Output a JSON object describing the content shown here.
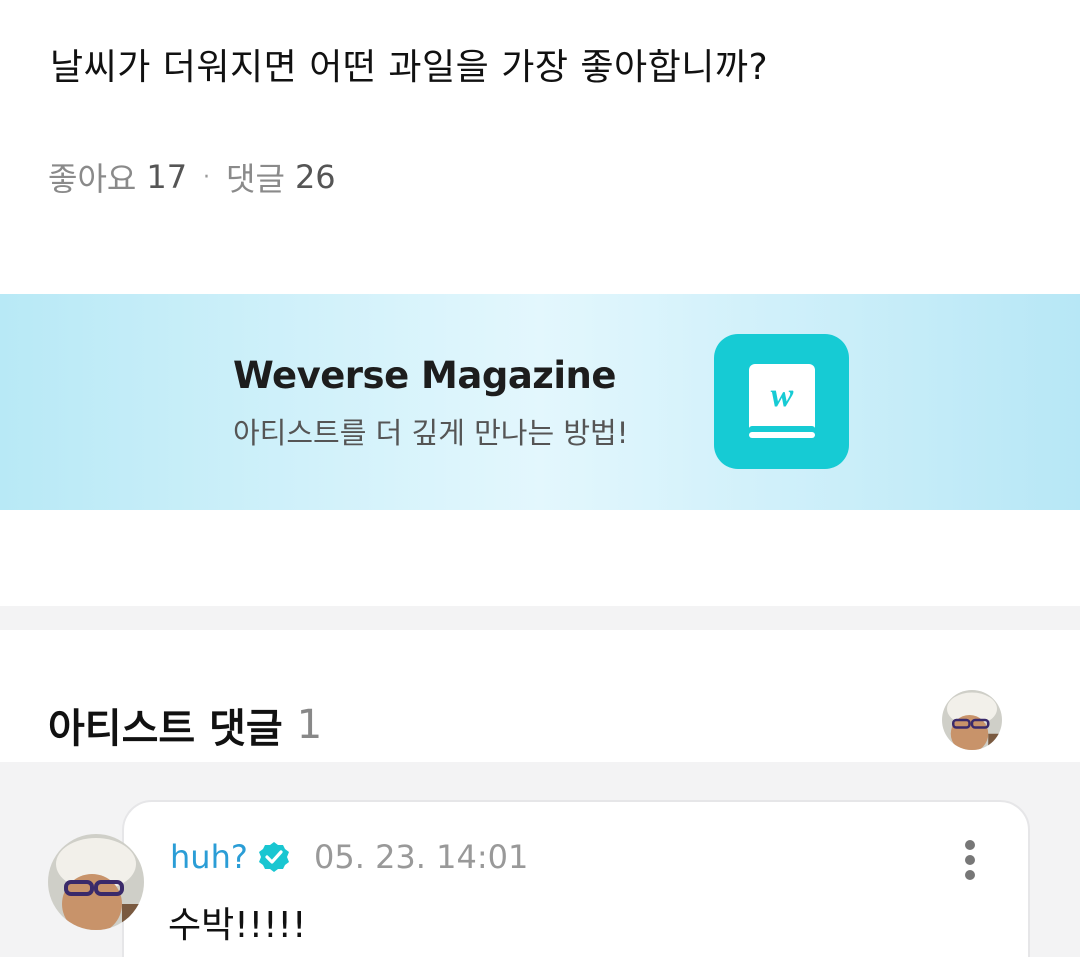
{
  "post": {
    "title": "날씨가 더워지면 어떤 과일을 가장 좋아합니까?",
    "likes_label": "좋아요",
    "likes_count": "17",
    "separator": "·",
    "comments_label": "댓글",
    "comments_count": "26"
  },
  "banner": {
    "title": "Weverse Magazine",
    "subtitle": "아티스트를 더 깊게 만나는 방법!",
    "app_icon": "weverse-magazine-book-icon",
    "brand_color": "#16cbd4"
  },
  "artist_comments": {
    "title": "아티스트 댓글",
    "count": "1"
  },
  "comment": {
    "author": "huh?",
    "verified_icon": "verified-badge-icon",
    "time": "05. 23. 14:01",
    "text": "수박!!!!!",
    "author_color": "#2a9dd6"
  }
}
